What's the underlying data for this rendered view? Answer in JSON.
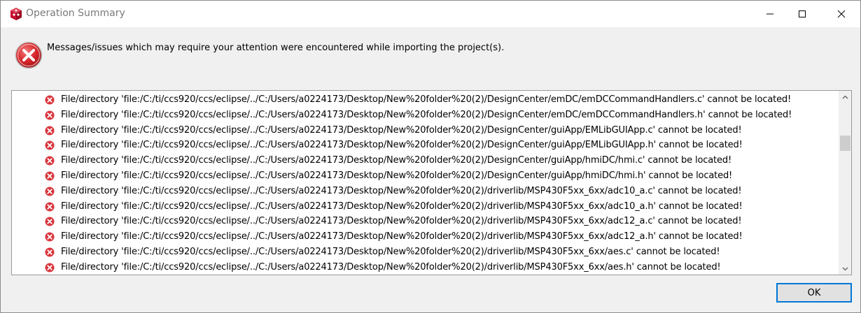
{
  "window": {
    "title": "Operation Summary",
    "icon": "ccs-cube-icon",
    "accent_color": "#0078d7"
  },
  "header": {
    "icon": "error-icon",
    "message": "Messages/issues which may require your attention were encountered while importing the project(s)."
  },
  "issues": [
    {
      "icon": "error-icon",
      "text": "File/directory 'file:/C:/ti/ccs920/ccs/eclipse/../C:/Users/a0224173/Desktop/New%20folder%20(2)/DesignCenter/emDC/emDCCommandHandlers.c' cannot be located!"
    },
    {
      "icon": "error-icon",
      "text": "File/directory 'file:/C:/ti/ccs920/ccs/eclipse/../C:/Users/a0224173/Desktop/New%20folder%20(2)/DesignCenter/emDC/emDCCommandHandlers.h' cannot be located!"
    },
    {
      "icon": "error-icon",
      "text": "File/directory 'file:/C:/ti/ccs920/ccs/eclipse/../C:/Users/a0224173/Desktop/New%20folder%20(2)/DesignCenter/guiApp/EMLibGUIApp.c' cannot be located!"
    },
    {
      "icon": "error-icon",
      "text": "File/directory 'file:/C:/ti/ccs920/ccs/eclipse/../C:/Users/a0224173/Desktop/New%20folder%20(2)/DesignCenter/guiApp/EMLibGUIApp.h' cannot be located!"
    },
    {
      "icon": "error-icon",
      "text": "File/directory 'file:/C:/ti/ccs920/ccs/eclipse/../C:/Users/a0224173/Desktop/New%20folder%20(2)/DesignCenter/guiApp/hmiDC/hmi.c' cannot be located!"
    },
    {
      "icon": "error-icon",
      "text": "File/directory 'file:/C:/ti/ccs920/ccs/eclipse/../C:/Users/a0224173/Desktop/New%20folder%20(2)/DesignCenter/guiApp/hmiDC/hmi.h' cannot be located!"
    },
    {
      "icon": "error-icon",
      "text": "File/directory 'file:/C:/ti/ccs920/ccs/eclipse/../C:/Users/a0224173/Desktop/New%20folder%20(2)/driverlib/MSP430F5xx_6xx/adc10_a.c' cannot be located!"
    },
    {
      "icon": "error-icon",
      "text": "File/directory 'file:/C:/ti/ccs920/ccs/eclipse/../C:/Users/a0224173/Desktop/New%20folder%20(2)/driverlib/MSP430F5xx_6xx/adc10_a.h' cannot be located!"
    },
    {
      "icon": "error-icon",
      "text": "File/directory 'file:/C:/ti/ccs920/ccs/eclipse/../C:/Users/a0224173/Desktop/New%20folder%20(2)/driverlib/MSP430F5xx_6xx/adc12_a.c' cannot be located!"
    },
    {
      "icon": "error-icon",
      "text": "File/directory 'file:/C:/ti/ccs920/ccs/eclipse/../C:/Users/a0224173/Desktop/New%20folder%20(2)/driverlib/MSP430F5xx_6xx/adc12_a.h' cannot be located!"
    },
    {
      "icon": "error-icon",
      "text": "File/directory 'file:/C:/ti/ccs920/ccs/eclipse/../C:/Users/a0224173/Desktop/New%20folder%20(2)/driverlib/MSP430F5xx_6xx/aes.c' cannot be located!"
    },
    {
      "icon": "error-icon",
      "text": "File/directory 'file:/C:/ti/ccs920/ccs/eclipse/../C:/Users/a0224173/Desktop/New%20folder%20(2)/driverlib/MSP430F5xx_6xx/aes.h' cannot be located!"
    }
  ],
  "footer": {
    "ok_label": "OK"
  }
}
